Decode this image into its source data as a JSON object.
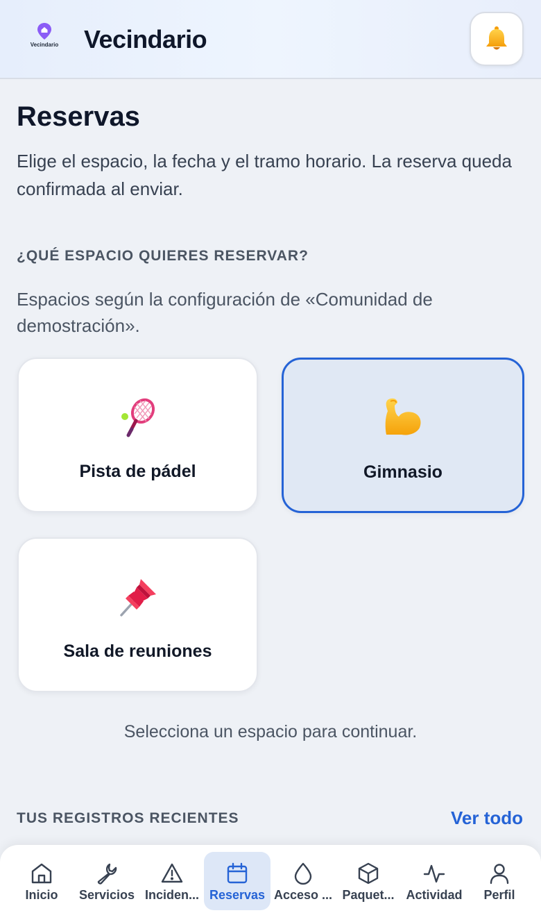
{
  "header": {
    "logo_text": "Vecindario",
    "title": "Vecindario",
    "notification_icon": "bell-icon"
  },
  "page": {
    "title": "Reservas",
    "description": "Elige el espacio, la fecha y el tramo horario. La reserva queda confirmada al enviar."
  },
  "space_section": {
    "label": "¿QUÉ ESPACIO QUIERES RESERVAR?",
    "description": "Espacios según la configuración de «Comunidad de demostración».",
    "spaces": [
      {
        "label": "Pista de pádel",
        "icon": "tennis-racket-icon",
        "selected": false
      },
      {
        "label": "Gimnasio",
        "icon": "flexed-biceps-icon",
        "selected": true
      },
      {
        "label": "Sala de reuniones",
        "icon": "pushpin-icon",
        "selected": false
      }
    ],
    "hint": "Selecciona un espacio para continuar."
  },
  "recent": {
    "label": "TUS REGISTROS RECIENTES",
    "see_all": "Ver todo"
  },
  "colors": {
    "accent": "#2563d6",
    "background": "#eef1f6",
    "selected_card": "#e0e8f4"
  },
  "nav": {
    "items": [
      {
        "label": "Inicio",
        "icon": "home-icon",
        "active": false
      },
      {
        "label": "Servicios",
        "icon": "wrench-icon",
        "active": false
      },
      {
        "label": "Inciden...",
        "icon": "warning-icon",
        "active": false
      },
      {
        "label": "Reservas",
        "icon": "calendar-icon",
        "active": true
      },
      {
        "label": "Acceso ...",
        "icon": "drop-icon",
        "active": false
      },
      {
        "label": "Paquet...",
        "icon": "package-icon",
        "active": false
      },
      {
        "label": "Actividad",
        "icon": "activity-icon",
        "active": false
      },
      {
        "label": "Perfil",
        "icon": "user-icon",
        "active": false
      }
    ]
  }
}
